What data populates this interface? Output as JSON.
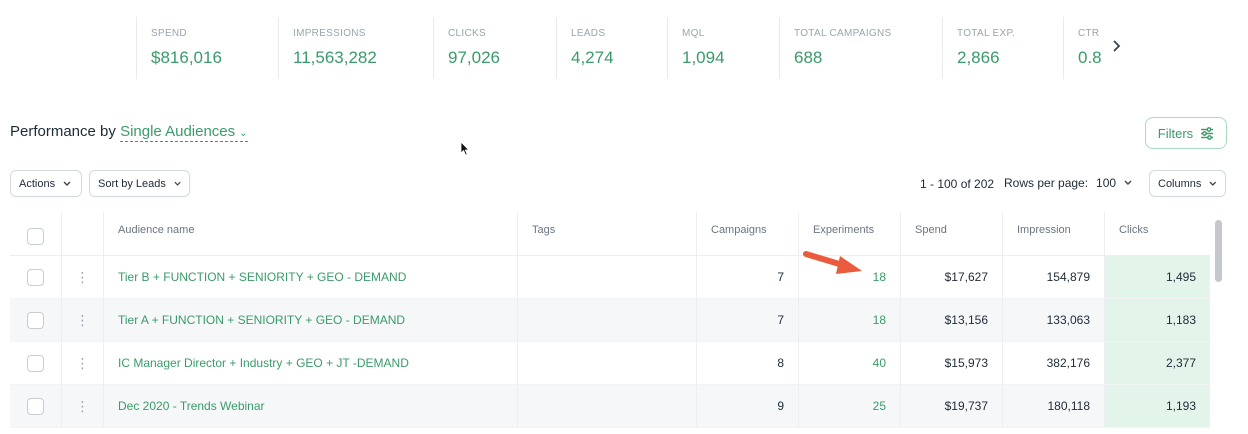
{
  "metrics": [
    {
      "label": "SPEND",
      "value": "$816,016"
    },
    {
      "label": "IMPRESSIONS",
      "value": "11,563,282"
    },
    {
      "label": "CLICKS",
      "value": "97,026"
    },
    {
      "label": "LEADS",
      "value": "4,274"
    },
    {
      "label": "MQL",
      "value": "1,094"
    },
    {
      "label": "TOTAL CAMPAIGNS",
      "value": "688"
    },
    {
      "label": "TOTAL EXP.",
      "value": "2,866"
    },
    {
      "label": "CTR",
      "value": "0.8"
    }
  ],
  "metrics_next_icon": "chevron-right-icon",
  "performance": {
    "prefix": "Performance by",
    "selected": "Single Audiences"
  },
  "filters_label": "Filters",
  "controls": {
    "actions_label": "Actions",
    "sort_label": "Sort by Leads",
    "pagination_text": "1 - 100 of 202",
    "rows_per_page_label": "Rows per page:",
    "rows_per_page_value": "100",
    "columns_label": "Columns"
  },
  "table": {
    "headers": {
      "name": "Audience name",
      "tags": "Tags",
      "campaigns": "Campaigns",
      "experiments": "Experiments",
      "spend": "Spend",
      "impression": "Impression",
      "clicks": "Clicks"
    },
    "rows": [
      {
        "name": "Tier B + FUNCTION + SENIORITY + GEO - DEMAND",
        "tags": "",
        "campaigns": "7",
        "experiments": "18",
        "spend": "$17,627",
        "impression": "154,879",
        "clicks": "1,495"
      },
      {
        "name": "Tier A + FUNCTION + SENIORITY + GEO - DEMAND",
        "tags": "",
        "campaigns": "7",
        "experiments": "18",
        "spend": "$13,156",
        "impression": "133,063",
        "clicks": "1,183"
      },
      {
        "name": "IC Manager Director + Industry + GEO + JT -DEMAND",
        "tags": "",
        "campaigns": "8",
        "experiments": "40",
        "spend": "$15,973",
        "impression": "382,176",
        "clicks": "2,377"
      },
      {
        "name": "Dec 2020 - Trends Webinar",
        "tags": "",
        "campaigns": "9",
        "experiments": "25",
        "spend": "$19,737",
        "impression": "180,118",
        "clicks": "1,193"
      }
    ]
  },
  "colors": {
    "accent_green": "#3a9b6a",
    "clicks_highlight": "#e3f5ea",
    "annotation_arrow": "#ea5a3d"
  }
}
